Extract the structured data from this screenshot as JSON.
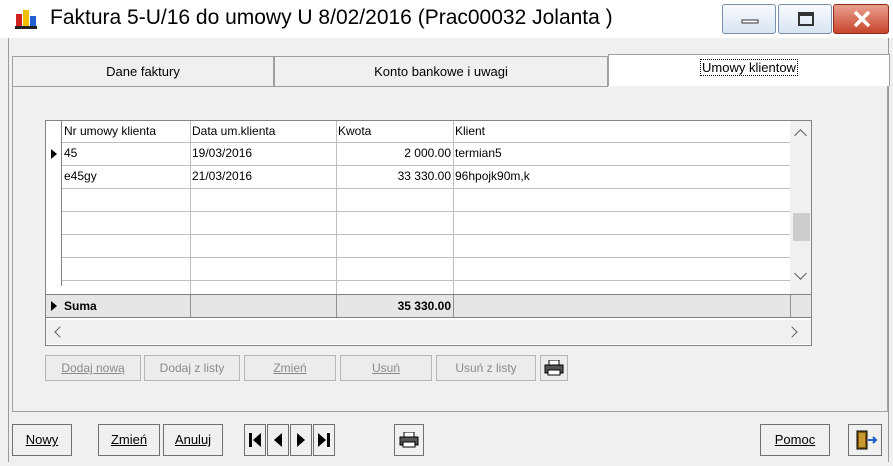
{
  "window": {
    "title": "Faktura 5-U/16 do umowy U 8/02/2016 (Prac00032 Jolanta )",
    "min_icon": "minimize-icon",
    "max_icon": "maximize-icon",
    "close_icon": "close-icon"
  },
  "tabs": [
    {
      "label": "Dane faktury",
      "active": false
    },
    {
      "label": "Konto bankowe i uwagi",
      "active": false
    },
    {
      "label": "Umowy klientow",
      "active": true
    }
  ],
  "grid": {
    "columns": [
      "Nr umowy klienta",
      "Data um.klienta",
      "Kwota",
      "Klient"
    ],
    "rows": [
      {
        "nr": "45",
        "data": "19/03/2016",
        "kwota": "2 000.00",
        "klient": "termian5"
      },
      {
        "nr": "e45gy",
        "data": "21/03/2016",
        "kwota": "33 330.00",
        "klient": "96hpojk90m,k"
      }
    ],
    "sum": {
      "label": "Suma",
      "kwota": "35 330.00"
    }
  },
  "grid_buttons": {
    "dodaj_nowa": "Dodaj nową",
    "dodaj_z_listy": "Dodaj z listy",
    "zmien": "Zmień",
    "usun": "Usuń",
    "usun_z_listy": "Usuń z listy",
    "print_icon": "printer-icon"
  },
  "bottom_buttons": {
    "nowy": "Nowy",
    "zmien": "Zmień",
    "anuluj": "Anuluj",
    "pomoc": "Pomoc",
    "exit_icon": "exit-door-icon"
  },
  "colors": {
    "accent": "#1e90ff",
    "close": "#c8452c"
  }
}
